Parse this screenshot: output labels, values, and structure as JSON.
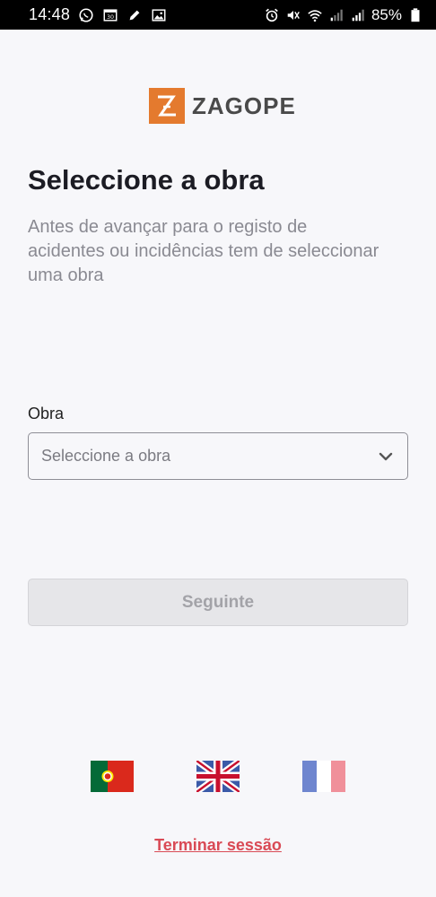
{
  "status_bar": {
    "time": "14:48",
    "battery": "85%",
    "left_icons": [
      "whatsapp-icon",
      "calendar-icon",
      "pencil-icon",
      "image-icon"
    ],
    "right_icons": [
      "alarm-icon",
      "mute-icon",
      "wifi-icon",
      "signal-icon",
      "signal-icon-2",
      "battery-icon"
    ]
  },
  "logo": {
    "text": "ZAGOPE",
    "mark_color": "#e47a2e"
  },
  "header": {
    "title": "Seleccione a obra",
    "subtitle": "Antes de avançar para o registo de acidentes ou incidências tem de seleccionar uma obra"
  },
  "form": {
    "label": "Obra",
    "select_placeholder": "Seleccione a obra",
    "next_label": "Seguinte",
    "next_disabled": true
  },
  "languages": [
    "Português",
    "English",
    "Français"
  ],
  "footer": {
    "logout_label": "Terminar sessão",
    "logout_color": "#d94a55"
  }
}
